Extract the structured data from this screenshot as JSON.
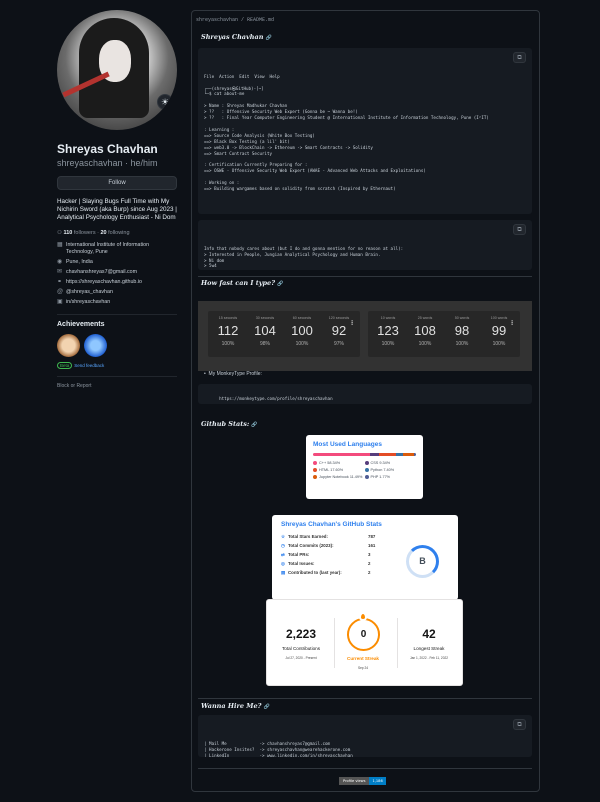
{
  "profile": {
    "name": "Shreyas Chavhan",
    "username": "shreyaschavhan",
    "pronouns": "he/him",
    "handle_line": "shreyaschavhan · he/him",
    "follow_button": "Follow",
    "bio": "Hacker | Slaying Bugs Full Time with My Nichirin Sword (aka Burp) since Aug 2023 | Analytical Psychology Enthusiast - Ni Dom",
    "followers_count": "110",
    "followers_label": "followers",
    "following_count": "20",
    "following_label": "following",
    "organization": "International Institute of Information Technology, Pune",
    "location": "Pune, India",
    "email": "chavhanshreyas7@gmail.com",
    "website": "https://shreyaschavhan.github.io",
    "twitter": "@shreyas_chavhan",
    "linkedin": "in/shreyaschavhan",
    "achievements_title": "Achievements",
    "achievement_count": "x2",
    "beta_label": "Beta",
    "send_feedback": "Send feedback",
    "block_report": "Block or Report"
  },
  "readme": {
    "path": "shreyaschavhan / README.md",
    "heading_about": "Shreyas Chavhan",
    "about_lines": [
      "File  Action  Edit  View  Help",
      "",
      "┌──(shreyas㉿GitHub)-[~]",
      "└─$ cat about-me",
      "",
      "> Name : Shreyas Madhukar Chavhan",
      "> ??   : Offensive Security Web Expert (Gonna be ~ Wanna be!)",
      "> ??   : Final Year Computer Engineering Student @ International Institute of Information Technology, Pune (I²IT)",
      "",
      ": Learning :",
      "==> Source Code Analysis (White Box Testing)",
      "==> Black Box Testing (a lil' bit)",
      "==> web3.0 -> BlockChain -> Ethereum -> Smart Contracts -> Solidity",
      "==> Smart Contract Security",
      "",
      ": Certification Currently Preparing for :",
      "==> OSWE - Offensive Security Web Expert (AWAE - Advanced Web Attacks and Exploitations)",
      "",
      ": Working on :",
      "==> Building wargames based on solidity from scratch (Inspired by Ethernaut)"
    ],
    "info_lines": [
      "Info that nobody cares about (but I do and gonna mention for no reason at all):",
      "> Interested in People, Jungian Analytical Psychology and Human Brain.",
      "> Ni dom",
      "> 5w4"
    ],
    "heading_typing": "How fast can I type?",
    "typing_time": {
      "labels": [
        "15 seconds",
        "30 seconds",
        "60 seconds",
        "120 seconds"
      ],
      "wpm": [
        "112",
        "104",
        "100",
        "92"
      ],
      "acc": [
        "100%",
        "98%",
        "100%",
        "97%"
      ]
    },
    "typing_words": {
      "labels": [
        "10 words",
        "25 words",
        "50 words",
        "100 words"
      ],
      "wpm": [
        "123",
        "108",
        "98",
        "99"
      ],
      "acc": [
        "100%",
        "100%",
        "100%",
        "100%"
      ]
    },
    "more_marker": "⁝",
    "monkeytype_label": "My MonkeyType Profile:",
    "monkeytype_url": "https://monkeytype.com/profile/shreyaschavhan",
    "heading_stats": "Github Stats:",
    "languages": {
      "title": "Most Used Languages",
      "items": [
        {
          "name": "C++ 58.34%",
          "color": "#f34b7d",
          "share": 58.34
        },
        {
          "name": "CSS 9.34%",
          "color": "#563d7c",
          "share": 9.34
        },
        {
          "name": "HTML 17.60%",
          "color": "#e34c26",
          "share": 17.6
        },
        {
          "name": "Python 7.40%",
          "color": "#3572a5",
          "share": 7.4
        },
        {
          "name": "Jupyter Notebook 11.49%",
          "color": "#da5b0b",
          "share": 11.49
        },
        {
          "name": "PHP 1.77%",
          "color": "#4f5d95",
          "share": 1.77
        }
      ]
    },
    "gh_stats": {
      "title": "Shreyas Chavhan's GitHub Stats",
      "rows": [
        {
          "k": "Total Stars Earned:",
          "v": "787"
        },
        {
          "k": "Total Commits (2023):",
          "v": "161"
        },
        {
          "k": "Total PRs:",
          "v": "3"
        },
        {
          "k": "Total Issues:",
          "v": "2"
        },
        {
          "k": "Contributed to (last year):",
          "v": "2"
        }
      ],
      "grade": "B"
    },
    "streak": {
      "total": "2,223",
      "total_label": "Total Contributions",
      "total_dates": "Jul 27, 2020 - Present",
      "current": "0",
      "current_label": "Current Streak",
      "current_date": "Sep 24",
      "longest": "42",
      "longest_label": "Longest Streak",
      "longest_dates": "Jan 1, 2022 - Feb 11, 2022"
    },
    "heading_hire": "Wanna Hire Me?",
    "hire_lines": [
      "| Mail Me             -> chavhanshreyas7@gmail.com",
      "| Hackerone Insites?  -> shreyaschavhan@wearehackerone.com",
      "| LinkedIn            -> www.linkedin.com/in/shreyaschavhan",
      "| Github              -> www.github.com/shreyaschavhan"
    ],
    "visits_label": "Profile views",
    "visits_value": "1,186"
  }
}
